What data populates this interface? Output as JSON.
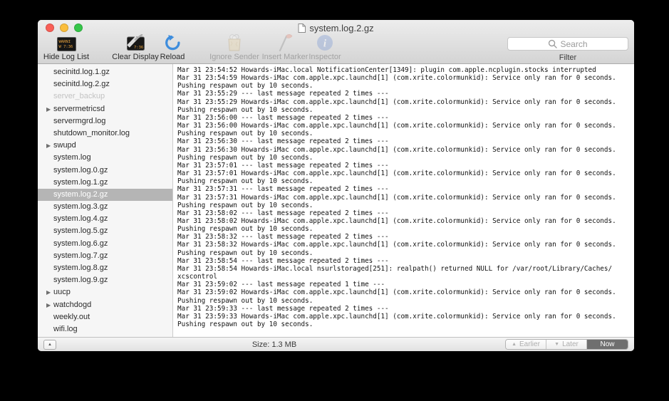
{
  "window": {
    "title": "system.log.2.gz"
  },
  "toolbar": {
    "hide_log_list": "Hide Log List",
    "clear_display": "Clear Display",
    "reload": "Reload",
    "ignore_sender": "Ignore Sender",
    "insert_marker": "Insert Marker",
    "inspector": "Inspector",
    "console_icon_text": "WARNI\nW 7:36",
    "search_placeholder": "Search",
    "filter_label": "Filter"
  },
  "sidebar": {
    "items": [
      {
        "label": "secinitd.log.1.gz"
      },
      {
        "label": "secinitd.log.2.gz"
      },
      {
        "label": "server_backup",
        "disabled": true
      },
      {
        "label": "servermetricsd",
        "disclosure": true
      },
      {
        "label": "servermgrd.log"
      },
      {
        "label": "shutdown_monitor.log"
      },
      {
        "label": "swupd",
        "disclosure": true
      },
      {
        "label": "system.log"
      },
      {
        "label": "system.log.0.gz"
      },
      {
        "label": "system.log.1.gz"
      },
      {
        "label": "system.log.2.gz",
        "selected": true
      },
      {
        "label": "system.log.3.gz"
      },
      {
        "label": "system.log.4.gz"
      },
      {
        "label": "system.log.5.gz"
      },
      {
        "label": "system.log.6.gz"
      },
      {
        "label": "system.log.7.gz"
      },
      {
        "label": "system.log.8.gz"
      },
      {
        "label": "system.log.9.gz"
      },
      {
        "label": "uucp",
        "disclosure": true
      },
      {
        "label": "watchdogd",
        "disclosure": true
      },
      {
        "label": "weekly.out"
      },
      {
        "label": "wifi.log"
      }
    ]
  },
  "log": {
    "lines": [
      "Mar 31 23:54:52 Howards-iMac.local NotificationCenter[1349]: plugin com.apple.ncplugin.stocks interrupted",
      "Mar 31 23:54:59 Howards-iMac com.apple.xpc.launchd[1] (com.xrite.colormunkid): Service only ran for 0 seconds.",
      "Pushing respawn out by 10 seconds.",
      "Mar 31 23:55:29 --- last message repeated 2 times ---",
      "Mar 31 23:55:29 Howards-iMac com.apple.xpc.launchd[1] (com.xrite.colormunkid): Service only ran for 0 seconds.",
      "Pushing respawn out by 10 seconds.",
      "Mar 31 23:56:00 --- last message repeated 2 times ---",
      "Mar 31 23:56:00 Howards-iMac com.apple.xpc.launchd[1] (com.xrite.colormunkid): Service only ran for 0 seconds.",
      "Pushing respawn out by 10 seconds.",
      "Mar 31 23:56:30 --- last message repeated 2 times ---",
      "Mar 31 23:56:30 Howards-iMac com.apple.xpc.launchd[1] (com.xrite.colormunkid): Service only ran for 0 seconds.",
      "Pushing respawn out by 10 seconds.",
      "Mar 31 23:57:01 --- last message repeated 2 times ---",
      "Mar 31 23:57:01 Howards-iMac com.apple.xpc.launchd[1] (com.xrite.colormunkid): Service only ran for 0 seconds.",
      "Pushing respawn out by 10 seconds.",
      "Mar 31 23:57:31 --- last message repeated 2 times ---",
      "Mar 31 23:57:31 Howards-iMac com.apple.xpc.launchd[1] (com.xrite.colormunkid): Service only ran for 0 seconds.",
      "Pushing respawn out by 10 seconds.",
      "Mar 31 23:58:02 --- last message repeated 2 times ---",
      "Mar 31 23:58:02 Howards-iMac com.apple.xpc.launchd[1] (com.xrite.colormunkid): Service only ran for 0 seconds.",
      "Pushing respawn out by 10 seconds.",
      "Mar 31 23:58:32 --- last message repeated 2 times ---",
      "Mar 31 23:58:32 Howards-iMac com.apple.xpc.launchd[1] (com.xrite.colormunkid): Service only ran for 0 seconds.",
      "Pushing respawn out by 10 seconds.",
      "Mar 31 23:58:54 --- last message repeated 2 times ---",
      "Mar 31 23:58:54 Howards-iMac.local nsurlstoraged[251]: realpath() returned NULL for /var/root/Library/Caches/",
      "xcscontrol",
      "Mar 31 23:59:02 --- last message repeated 1 time ---",
      "Mar 31 23:59:02 Howards-iMac com.apple.xpc.launchd[1] (com.xrite.colormunkid): Service only ran for 0 seconds.",
      "Pushing respawn out by 10 seconds.",
      "Mar 31 23:59:33 --- last message repeated 2 times ---",
      "Mar 31 23:59:33 Howards-iMac com.apple.xpc.launchd[1] (com.xrite.colormunkid): Service only ran for 0 seconds.",
      "Pushing respawn out by 10 seconds."
    ]
  },
  "statusbar": {
    "size": "Size: 1.3 MB",
    "earlier": "Earlier",
    "later": "Later",
    "now": "Now"
  },
  "colors": {
    "selection_gray": "#b5b5b5",
    "reload_blue": "#3e8ddd",
    "traffic_red": "#f95f57",
    "traffic_yellow": "#fbbe3c",
    "traffic_green": "#35c649"
  }
}
